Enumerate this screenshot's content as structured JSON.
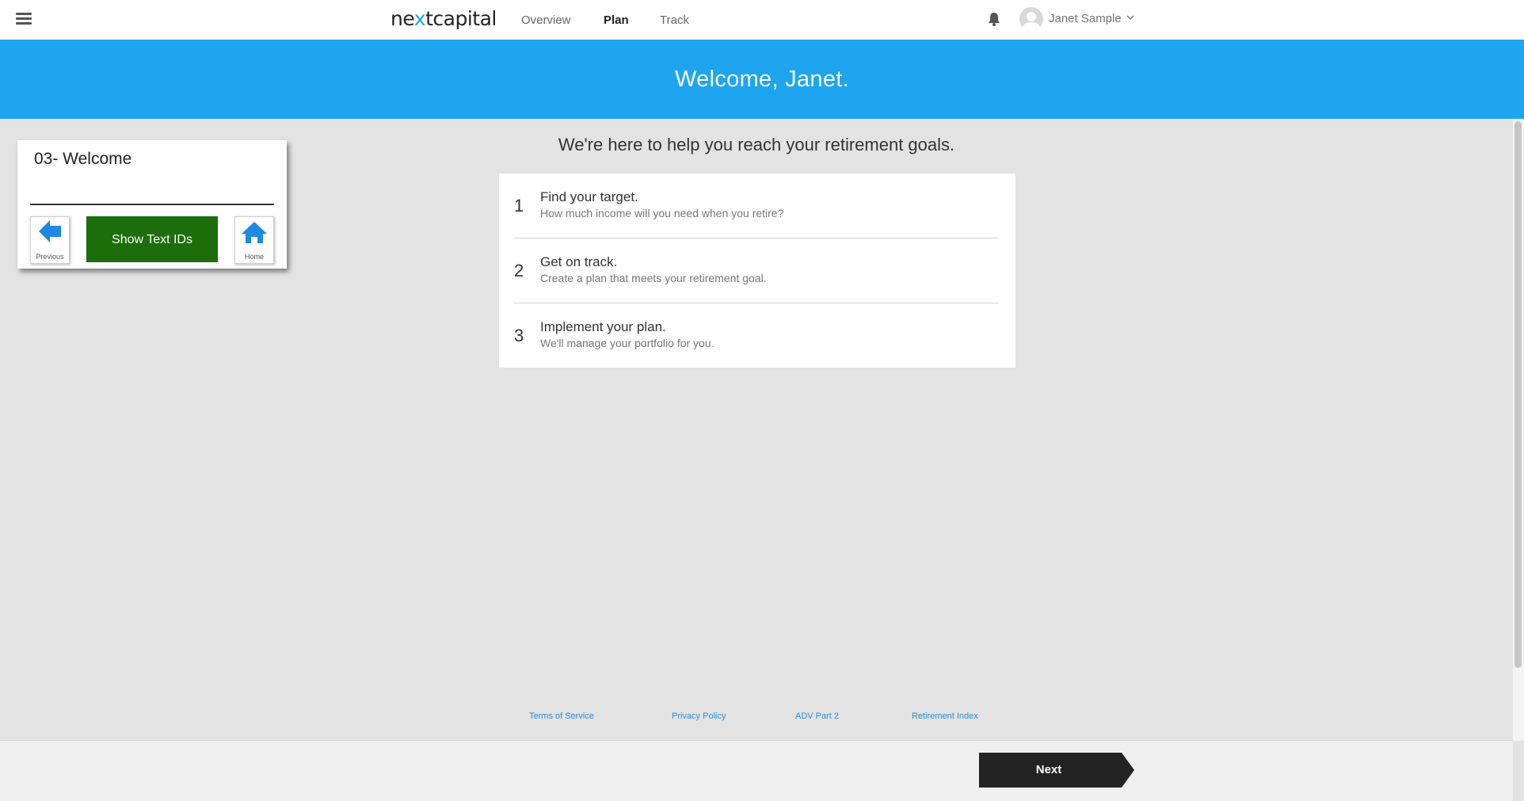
{
  "header": {
    "logo_pre": "ne",
    "logo_x": "x",
    "logo_post": "tcapital",
    "nav": [
      {
        "label": "Overview",
        "active": false
      },
      {
        "label": "Plan",
        "active": true
      },
      {
        "label": "Track",
        "active": false
      }
    ],
    "user_name": "Janet Sample",
    "icons": [
      "menu-icon",
      "bell-icon",
      "avatar",
      "chevron-down-icon"
    ]
  },
  "banner": {
    "title": "Welcome, Janet.",
    "color": "#1ea5f0"
  },
  "control_card": {
    "title": "03- Welcome",
    "previous_label": "Previous",
    "show_label": "Show Text IDs",
    "home_label": "Home",
    "show_color": "#1c6d0b",
    "icon_color": "#1e88e5"
  },
  "main": {
    "subheading": "We're here to help you reach your retirement goals.",
    "steps": [
      {
        "num": "1",
        "title": "Find your target.",
        "desc": "How much income will you need when you retire?"
      },
      {
        "num": "2",
        "title": "Get on track.",
        "desc": "Create a plan that meets your retirement goal."
      },
      {
        "num": "3",
        "title": "Implement your plan.",
        "desc": "We'll manage your portfolio for you."
      }
    ]
  },
  "footer": {
    "links": [
      "Terms of Service",
      "Privacy Policy",
      "ADV Part 2",
      "Retirement Index"
    ],
    "next_label": "Next"
  }
}
